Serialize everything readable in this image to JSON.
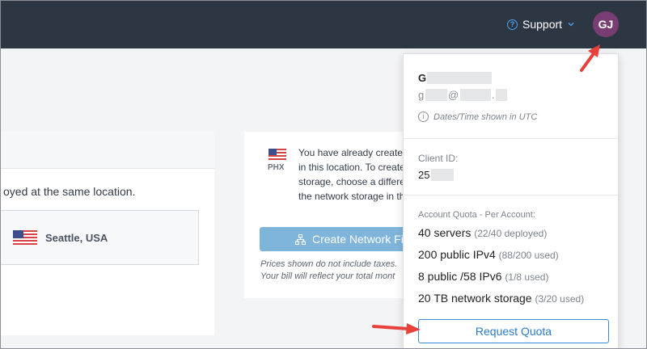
{
  "header": {
    "support_label": "Support",
    "avatar_initials": "GJ"
  },
  "left_panel": {
    "deploy_text": "oyed at the same location.",
    "location_label": "Seattle, USA"
  },
  "middle_panel": {
    "location_code": "PHX",
    "notice_lines": [
      "You have already created",
      "in this location. To create",
      "storage, choose a differen",
      "the network storage in the"
    ],
    "create_button_label": "Create Network File",
    "prices_lines": [
      "Prices shown do not include taxes.",
      "Your bill will reflect your total mont"
    ]
  },
  "account_menu": {
    "name_first_letter": "G",
    "email_start": "g",
    "email_at": "@",
    "email_dot": ".",
    "timezone_note": "Dates/Time shown in UTC",
    "client_id_label": "Client ID:",
    "client_id_value": "25",
    "quota_label": "Account Quota - Per Account:",
    "quotas": [
      {
        "main": "40 servers",
        "used": "(22/40 deployed)"
      },
      {
        "main": "200 public IPv4",
        "used": "(88/200 used)"
      },
      {
        "main": "8 public /58 IPv6",
        "used": "(1/8 used)"
      },
      {
        "main": "20 TB network storage",
        "used": "(3/20 used)"
      }
    ],
    "request_button_label": "Request Quota"
  },
  "colors": {
    "topbar": "#2d3744",
    "avatar": "#7a3d73",
    "accent_blue": "#2b7bd0",
    "create_button": "#7fb5db",
    "annotation_arrow": "#e8403a"
  },
  "icons": {
    "support": "question-circle-icon",
    "info": "info-circle-icon",
    "flag": "us-flag-icon",
    "network": "network-icon"
  }
}
